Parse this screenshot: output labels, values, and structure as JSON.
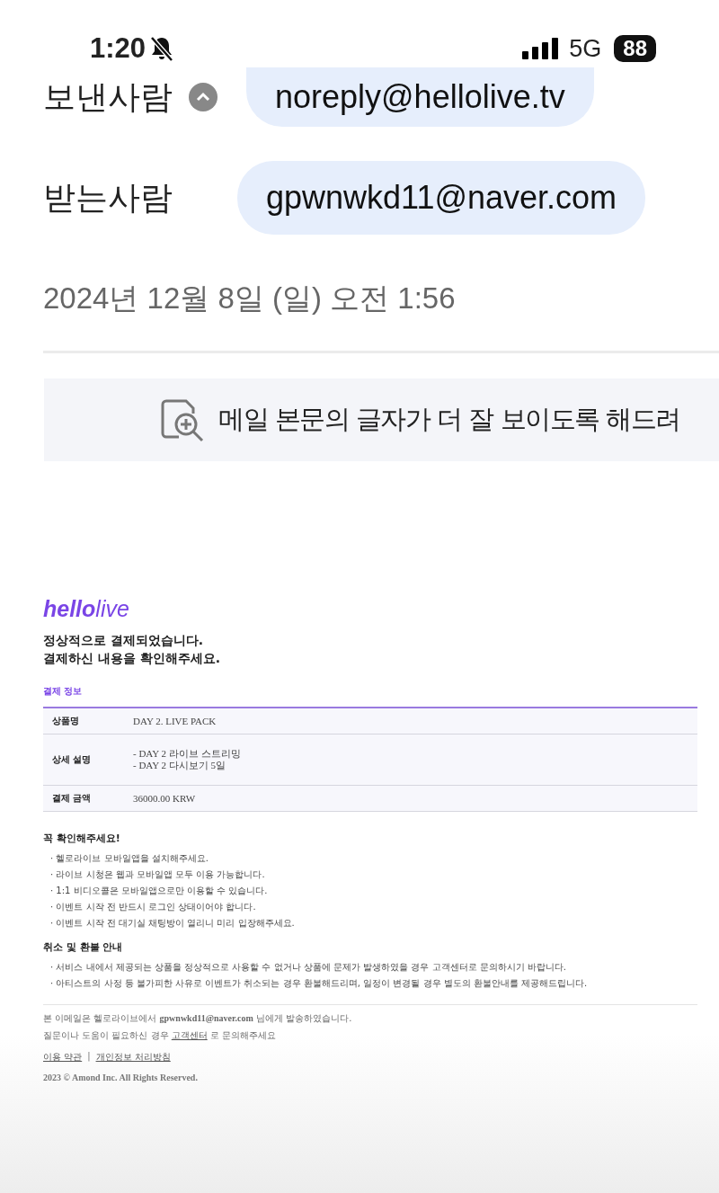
{
  "status_bar": {
    "time": "1:20",
    "network": "5G",
    "battery": "88"
  },
  "header": {
    "sender_label": "보낸사람",
    "sender": "noreply@hellolive.tv",
    "recipient_label": "받는사람",
    "recipient": "gpwnwkd11@naver.com",
    "date": "2024년 12월 8일 (일) 오전 1:56"
  },
  "banner": {
    "text": "메일 본문의 글자가 더 잘 보이도록 해드려"
  },
  "email": {
    "logo": "**hello**live",
    "headline": [
      "정상적으로 결제되었습니다.",
      "결제하신 내용을 확인해주세요."
    ],
    "section_title": "결제 정보",
    "rows": [
      {
        "label": "상품명",
        "values": [
          "DAY 2. LIVE PACK"
        ]
      },
      {
        "label": "상세 설명",
        "values": [
          "- DAY 2 라이브 스트리밍",
          "- DAY 2 다시보기 5일"
        ]
      },
      {
        "label": "결제 금액",
        "values": [
          "36000.00 KRW"
        ]
      }
    ],
    "notice_title": "꼭 확인해주세요!",
    "notices": [
      "· 헬로라이브 모바일앱을 설치해주세요.",
      "· 라이브 시청은 웹과 모바일앱 모두 이용 가능합니다.",
      "· 1:1 비디오콜은 모바일앱으로만 이용할 수 있습니다.",
      "· 이벤트 시작 전 반드시 로그인 상태이어야 합니다.",
      "· 이벤트 시작 전 대기실 채팅방이 열리니 미리 입장해주세요."
    ],
    "refund_title": "취소 및 환불 안내",
    "refunds": [
      "· 서비스 내에서 제공되는 상품을 정상적으로 사용할 수 없거나 상품에 문제가 발생하였을 경우 고객센터로 문의하시기 바랍니다.",
      "· 아티스트의 사정 등 불가피한 사유로 이벤트가 취소되는 경우 환불해드리며, 일정이 변경될 경우 별도의 환불안내를 제공해드립니다."
    ],
    "footer_line1": "본 이메일은 헬로라이브에서 **gpwnwkd11@naver.com** 님에게 발송하였습니다.",
    "footer_line2_before": "질문이나 도움이 필요하신 경우",
    "footer_link": "고객센터",
    "footer_line2_after": "로 문의해주세요",
    "links": [
      "이용 약관",
      "개인정보 처리방침"
    ],
    "link_separator": "|",
    "copyright": "2023 © Amond Inc. All Rights Reserved."
  }
}
